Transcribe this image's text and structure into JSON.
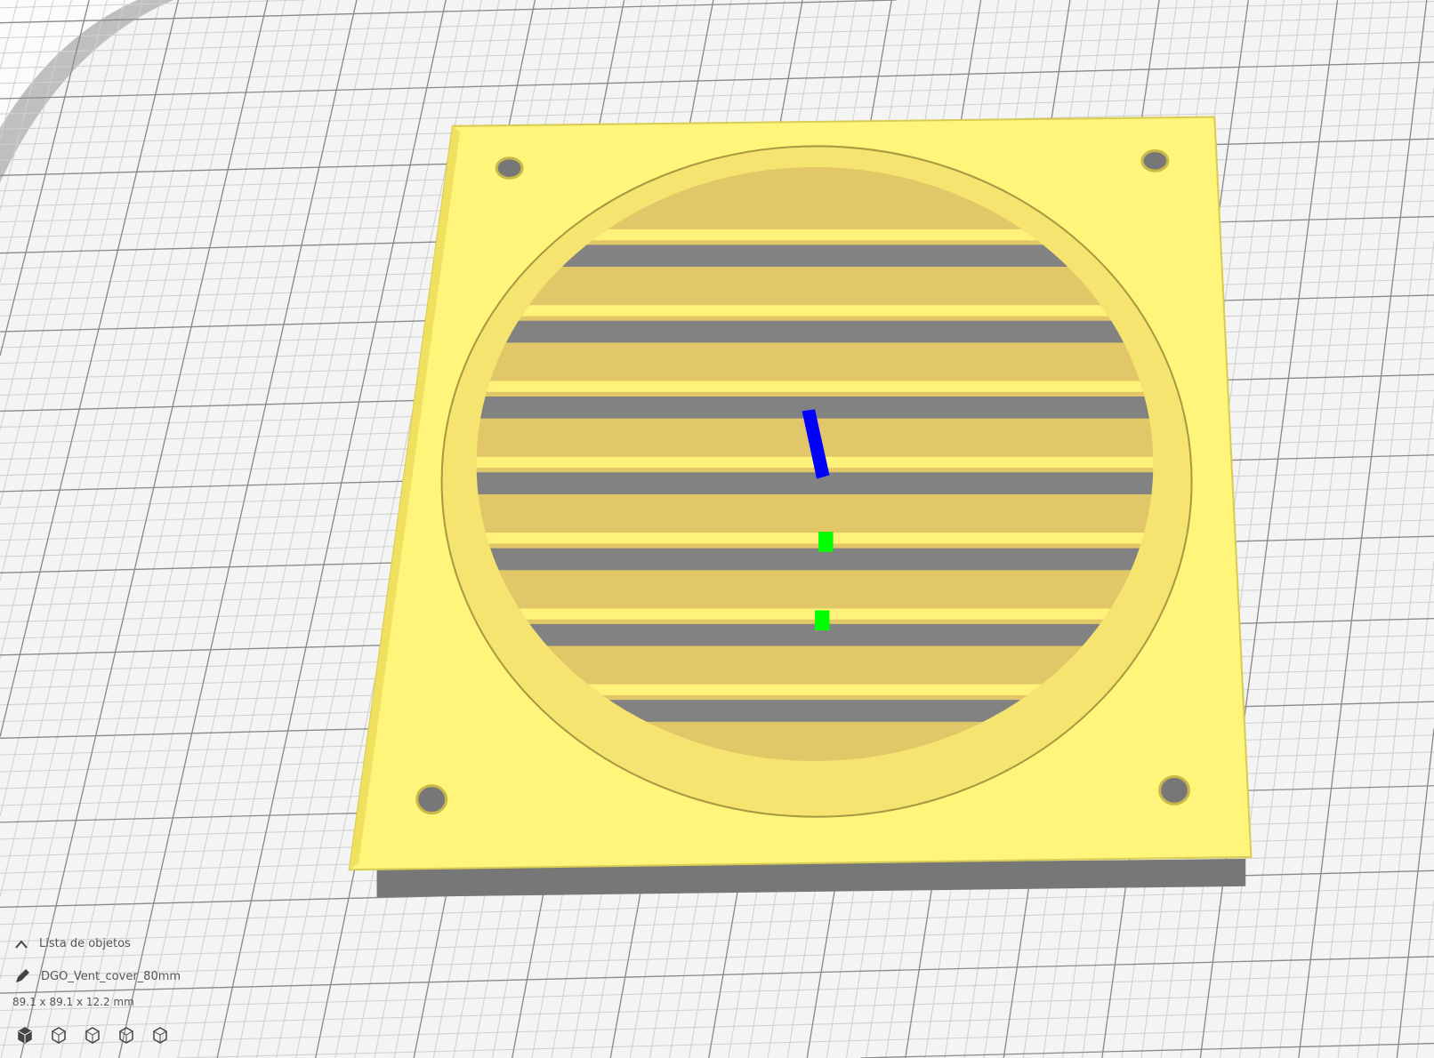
{
  "object_list": {
    "label": "Lista de objetos",
    "icon": "chevron-up-icon"
  },
  "object": {
    "name": "DGO_Vent_cover_80mm",
    "icon": "pencil-icon",
    "dimensions": "89.1 x 89.1 x 12.2 mm"
  },
  "view_buttons": [
    {
      "name": "3d-view",
      "icon": "cube-solid-icon"
    },
    {
      "name": "front-view",
      "icon": "cube-front-icon"
    },
    {
      "name": "top-view",
      "icon": "cube-top-icon"
    },
    {
      "name": "left-view",
      "icon": "cube-left-icon"
    },
    {
      "name": "right-view",
      "icon": "cube-right-icon"
    }
  ],
  "colors": {
    "model": "#fff57a",
    "model_shade": "#e0c565",
    "grid": "#c8c8c8",
    "background": "#f2f2f2",
    "axis_z": "#0000ff",
    "axis_y": "#00ff00"
  }
}
